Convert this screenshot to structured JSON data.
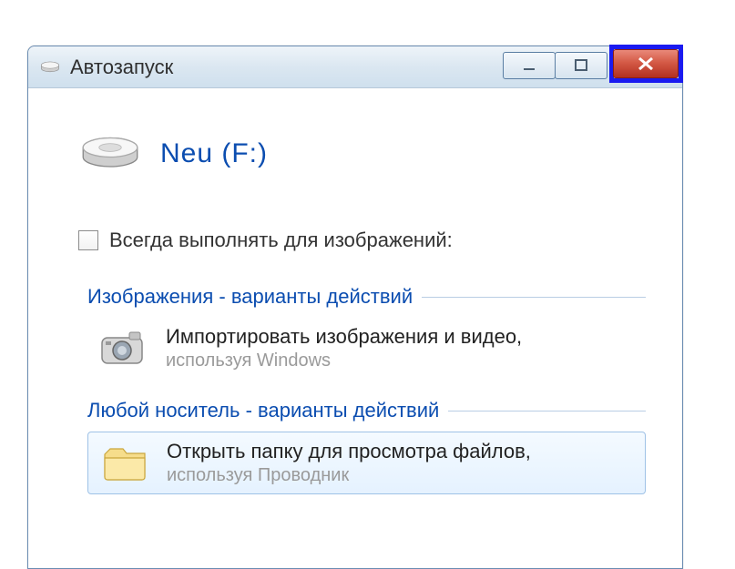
{
  "window": {
    "title": "Автозапуск"
  },
  "drive": {
    "name": "Neu (F:)"
  },
  "checkbox": {
    "label": "Всегда выполнять для изображений:"
  },
  "sections": [
    {
      "header": "Изображения - варианты действий",
      "items": [
        {
          "icon": "camera-icon",
          "main": "Импортировать изображения и видео,",
          "sub": "используя Windows",
          "selected": false
        }
      ]
    },
    {
      "header": "Любой носитель - варианты действий",
      "items": [
        {
          "icon": "folder-icon",
          "main": "Открыть папку для просмотра файлов,",
          "sub": "используя Проводник",
          "selected": true
        }
      ]
    }
  ]
}
